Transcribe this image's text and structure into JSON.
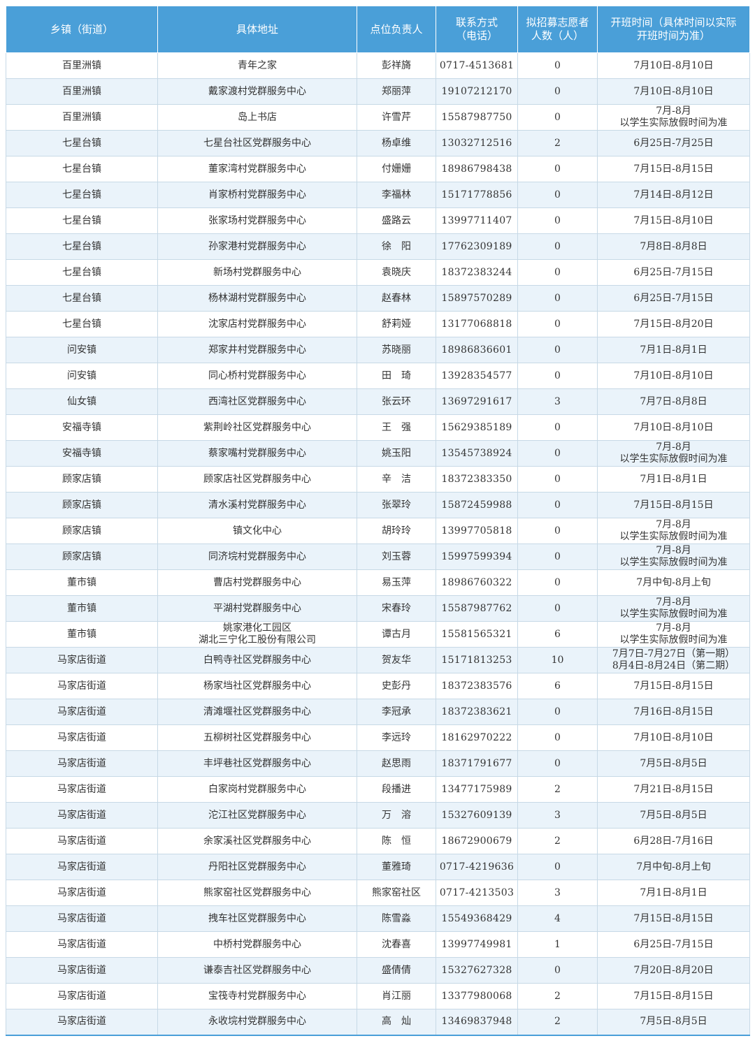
{
  "table": {
    "headers": [
      "乡镇（街道）",
      "具体地址",
      "点位负责人",
      "联系方式\n（电话）",
      "拟招募志愿者\n人数（人）",
      "开班时间（具体时间以实际\n开班时间为准）"
    ],
    "rows": [
      [
        "百里洲镇",
        "青年之家",
        "彭祥旖",
        "0717-4513681",
        "0",
        "7月10日-8月10日"
      ],
      [
        "百里洲镇",
        "戴家渡村党群服务中心",
        "郑丽萍",
        "19107212170",
        "0",
        "7月10日-8月10日"
      ],
      [
        "百里洲镇",
        "岛上书店",
        "许雪芹",
        "15587987750",
        "0",
        "7月-8月\n以学生实际放假时间为准"
      ],
      [
        "七星台镇",
        "七星台社区党群服务中心",
        "杨卓维",
        "13032712516",
        "2",
        "6月25日-7月25日"
      ],
      [
        "七星台镇",
        "董家湾村党群服务中心",
        "付姗姗",
        "18986798438",
        "0",
        "7月15日-8月15日"
      ],
      [
        "七星台镇",
        "肖家桥村党群服务中心",
        "李福林",
        "15171778856",
        "0",
        "7月14日-8月12日"
      ],
      [
        "七星台镇",
        "张家场村党群服务中心",
        "盛路云",
        "13997711407",
        "0",
        "7月15日-8月10日"
      ],
      [
        "七星台镇",
        "孙家港村党群服务中心",
        "徐　阳",
        "17762309189",
        "0",
        "7月8日-8月8日"
      ],
      [
        "七星台镇",
        "新场村党群服务中心",
        "袁晓庆",
        "18372383244",
        "0",
        "6月25日-7月15日"
      ],
      [
        "七星台镇",
        "杨林湖村党群服务中心",
        "赵春林",
        "15897570289",
        "0",
        "6月25日-7月15日"
      ],
      [
        "七星台镇",
        "沈家店村党群服务中心",
        "舒莉娅",
        "13177068818",
        "0",
        "7月15日-8月20日"
      ],
      [
        "问安镇",
        "郑家井村党群服务中心",
        "苏晓丽",
        "18986836601",
        "0",
        "7月1日-8月1日"
      ],
      [
        "问安镇",
        "同心桥村党群服务中心",
        "田　琦",
        "13928354577",
        "0",
        "7月10日-8月10日"
      ],
      [
        "仙女镇",
        "西湾社区党群服务中心",
        "张云环",
        "13697291617",
        "3",
        "7月7日-8月8日"
      ],
      [
        "安福寺镇",
        "紫荆岭社区党群服务中心",
        "王　强",
        "15629385189",
        "0",
        "7月10日-8月10日"
      ],
      [
        "安福寺镇",
        "蔡家嘴村党群服务中心",
        "姚玉阳",
        "13545738924",
        "0",
        "7月-8月\n以学生实际放假时间为准"
      ],
      [
        "顾家店镇",
        "顾家店社区党群服务中心",
        "辛　洁",
        "18372383350",
        "0",
        "7月1日-8月1日"
      ],
      [
        "顾家店镇",
        "清水溪村党群服务中心",
        "张翠玲",
        "15872459988",
        "0",
        "7月15日-8月15日"
      ],
      [
        "顾家店镇",
        "镇文化中心",
        "胡玲玲",
        "13997705818",
        "0",
        "7月-8月\n以学生实际放假时间为准"
      ],
      [
        "顾家店镇",
        "同济垸村党群服务中心",
        "刘玉蓉",
        "15997599394",
        "0",
        "7月-8月\n以学生实际放假时间为准"
      ],
      [
        "董市镇",
        "曹店村党群服务中心",
        "易玉萍",
        "18986760322",
        "0",
        "7月中旬-8月上旬"
      ],
      [
        "董市镇",
        "平湖村党群服务中心",
        "宋春玲",
        "15587987762",
        "0",
        "7月-8月\n以学生实际放假时间为准"
      ],
      [
        "董市镇",
        "姚家港化工园区\n湖北三宁化工股份有限公司",
        "谭古月",
        "15581565321",
        "6",
        "7月-8月\n以学生实际放假时间为准"
      ],
      [
        "马家店街道",
        "白鸭寺社区党群服务中心",
        "贺友华",
        "15171813253",
        "10",
        "7月7日-7月27日（第一期）\n8月4日-8月24日（第二期）"
      ],
      [
        "马家店街道",
        "杨家垱社区党群服务中心",
        "史彭丹",
        "18372383576",
        "6",
        "7月15日-8月15日"
      ],
      [
        "马家店街道",
        "清滩堰社区党群服务中心",
        "李冠承",
        "18372383621",
        "0",
        "7月16日-8月15日"
      ],
      [
        "马家店街道",
        "五柳树社区党群服务中心",
        "李远玲",
        "18162970222",
        "0",
        "7月10日-8月10日"
      ],
      [
        "马家店街道",
        "丰坪巷社区党群服务中心",
        "赵思雨",
        "18371791677",
        "0",
        "7月5日-8月5日"
      ],
      [
        "马家店街道",
        "白家岗村党群服务中心",
        "段播进",
        "13477175989",
        "2",
        "7月21日-8月15日"
      ],
      [
        "马家店街道",
        "沱江社区党群服务中心",
        "万　溶",
        "15327609139",
        "3",
        "7月5日-8月5日"
      ],
      [
        "马家店街道",
        "余家溪社区党群服务中心",
        "陈　恒",
        "18672900679",
        "2",
        "6月28日-7月16日"
      ],
      [
        "马家店街道",
        "丹阳社区党群服务中心",
        "董雅琦",
        "0717-4219636",
        "0",
        "7月中旬-8月上旬"
      ],
      [
        "马家店街道",
        "熊家窑社区党群服务中心",
        "熊家窑社区",
        "0717-4213503",
        "3",
        "7月1日-8月1日"
      ],
      [
        "马家店街道",
        "拽车社区党群服务中心",
        "陈雪淼",
        "15549368429",
        "4",
        "7月15日-8月15日"
      ],
      [
        "马家店街道",
        "中桥村党群服务中心",
        "沈春喜",
        "13997749981",
        "1",
        "6月25日-7月15日"
      ],
      [
        "马家店街道",
        "谦泰吉社区党群服务中心",
        "盛倩倩",
        "15327627328",
        "0",
        "7月20日-8月20日"
      ],
      [
        "马家店街道",
        "宝筏寺村党群服务中心",
        "肖江丽",
        "13377980068",
        "2",
        "7月15日-8月15日"
      ],
      [
        "马家店街道",
        "永收垸村党群服务中心",
        "高　灿",
        "13469837948",
        "2",
        "7月5日-8月5日"
      ]
    ]
  },
  "colors": {
    "header_bg": "#4a9fd8",
    "stripe_bg": "#eaf3fa",
    "grid": "#c7d9e6"
  }
}
